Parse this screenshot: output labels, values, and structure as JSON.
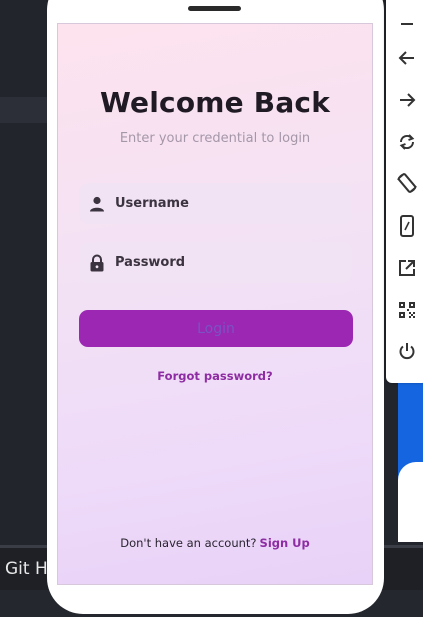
{
  "background": {
    "tab_text": "Git Hi"
  },
  "login": {
    "title": "Welcome Back",
    "subtitle": "Enter your credential to login",
    "username_placeholder": "Username",
    "password_placeholder": "Password",
    "login_label": "Login",
    "forgot_label": "Forgot password?",
    "signup_prompt": "Don't have an account?",
    "signup_label": "Sign Up"
  },
  "toolbar": {
    "icons": [
      "minimize-icon",
      "back-icon",
      "forward-icon",
      "rotate-icon",
      "rotate-device-icon",
      "device-frame-icon",
      "open-external-icon",
      "qr-code-icon",
      "power-icon"
    ]
  },
  "colors": {
    "accent": "#9b27b2",
    "link": "#8e2ca3",
    "field_bg": "#f1e3f3",
    "title": "#1f1a24"
  }
}
